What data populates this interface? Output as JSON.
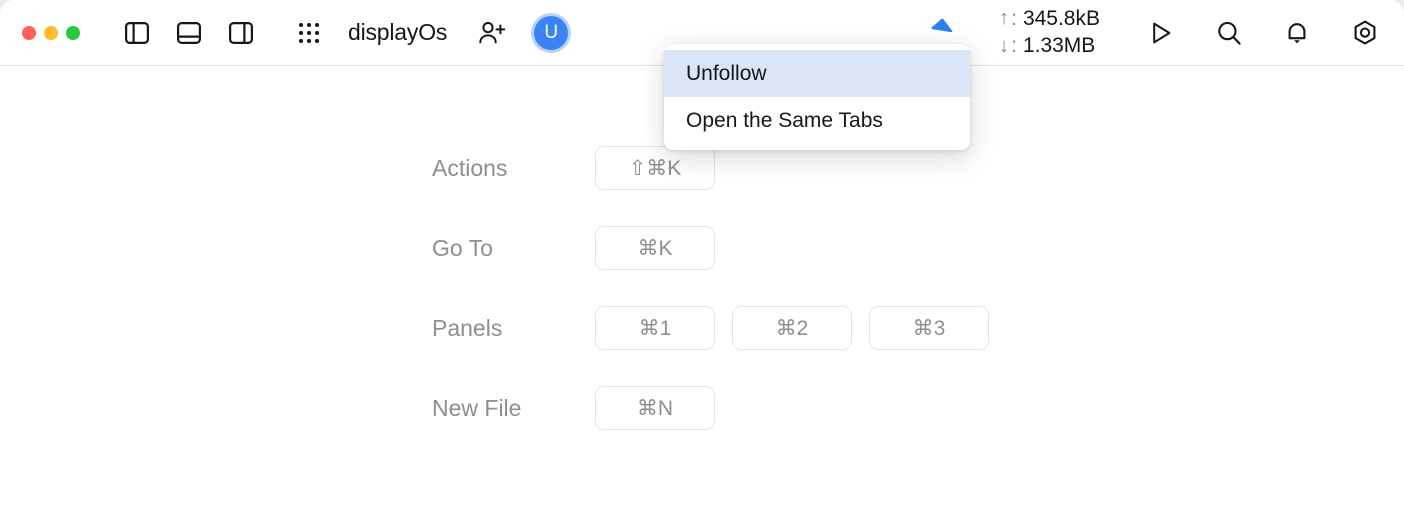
{
  "window": {
    "traffic_lights": [
      {
        "name": "close",
        "color": "#ff5f57"
      },
      {
        "name": "minimize",
        "color": "#febc2e"
      },
      {
        "name": "zoom",
        "color": "#28c840"
      }
    ]
  },
  "toolbar": {
    "app_title": "displayOs",
    "panel_icons": [
      {
        "name": "toggle-left-sidebar-icon"
      },
      {
        "name": "toggle-bottom-panel-icon"
      },
      {
        "name": "toggle-right-sidebar-icon"
      }
    ],
    "apps_grid_icon": "apps-grid-icon",
    "add_person_icon": "add-person-icon",
    "avatar": {
      "initial": "U",
      "color": "#3b82f6"
    },
    "network": {
      "upload_arrow": "↑",
      "upload_value": "345.8kB",
      "download_arrow": "↓",
      "download_value": "1.33MB",
      "separator": ":"
    },
    "right_icons": [
      {
        "name": "play-icon"
      },
      {
        "name": "search-icon"
      },
      {
        "name": "notifications-bell-icon"
      },
      {
        "name": "settings-gear-icon"
      }
    ]
  },
  "context_menu": {
    "items": [
      {
        "label": "Unfollow",
        "highlighted": true
      },
      {
        "label": "Open the Same Tabs",
        "highlighted": false
      }
    ],
    "highlight_color": "#d8e6f8"
  },
  "cursor": {
    "name": "pointer-cursor",
    "color": "#2b7fee"
  },
  "shortcuts": {
    "rows": [
      {
        "label": "Actions",
        "keys": [
          "⇧⌘K"
        ]
      },
      {
        "label": "Go To",
        "keys": [
          "⌘K"
        ]
      },
      {
        "label": "Panels",
        "keys": [
          "⌘1",
          "⌘2",
          "⌘3"
        ]
      },
      {
        "label": "New File",
        "keys": [
          "⌘N"
        ]
      }
    ]
  }
}
